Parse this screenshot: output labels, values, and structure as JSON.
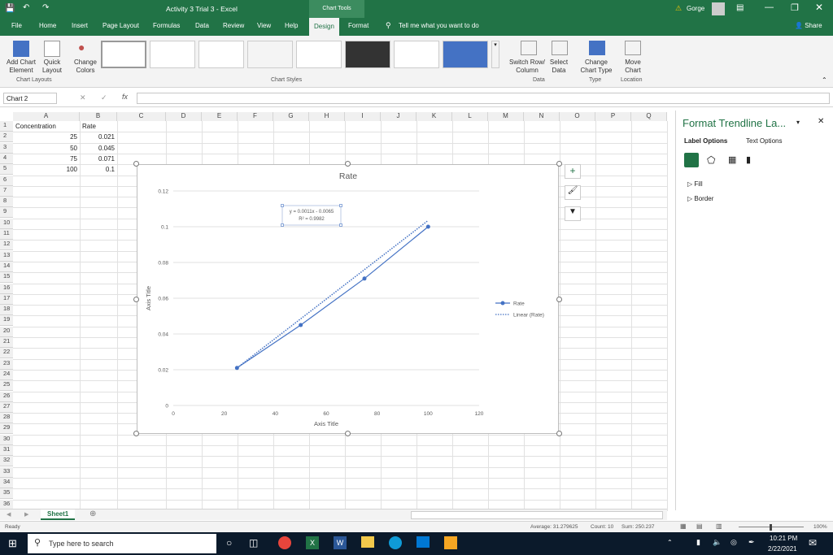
{
  "titlebar": {
    "title": "Activity 3 Trial 3  -  Excel",
    "contextual": "Chart Tools",
    "user": "Gorge"
  },
  "tabs": [
    "File",
    "Home",
    "Insert",
    "Page Layout",
    "Formulas",
    "Data",
    "Review",
    "View",
    "Help",
    "Design",
    "Format"
  ],
  "tell_me": "Tell me what you want to do",
  "share": "Share",
  "ribbon": {
    "add_chart_element": "Add Chart\nElement",
    "quick_layout": "Quick\nLayout",
    "change_colors": "Change\nColors",
    "switch_row_col": "Switch Row/\nColumn",
    "select_data": "Select\nData",
    "change_chart_type": "Change\nChart Type",
    "move_chart": "Move\nChart",
    "groups": {
      "chart_layouts": "Chart Layouts",
      "chart_styles": "Chart Styles",
      "data": "Data",
      "type": "Type",
      "location": "Location"
    }
  },
  "formula": {
    "name_box": "Chart 2",
    "fx": "fx"
  },
  "columns": [
    "A",
    "B",
    "C",
    "D",
    "E",
    "F",
    "G",
    "H",
    "I",
    "J",
    "K",
    "L",
    "M",
    "N",
    "O",
    "P",
    "Q"
  ],
  "rows": [
    "1",
    "2",
    "3",
    "4",
    "5",
    "6",
    "7",
    "8",
    "9",
    "10",
    "11",
    "12",
    "13",
    "14",
    "15",
    "16",
    "17",
    "18",
    "19",
    "20",
    "21",
    "22",
    "23",
    "24",
    "25",
    "26",
    "27",
    "28",
    "29",
    "30",
    "31",
    "32",
    "33",
    "34",
    "35",
    "36"
  ],
  "cells": {
    "A1": "Concentration",
    "B1": "Rate",
    "A2": "25",
    "B2": "0.021",
    "A3": "50",
    "B3": "0.045",
    "A4": "75",
    "B4": "0.071",
    "A5": "100",
    "B5": "0.1"
  },
  "chart_data": {
    "type": "scatter",
    "title": "Rate",
    "xlabel": "Axis Title",
    "ylabel": "Axis Title",
    "xlim": [
      0,
      120
    ],
    "ylim": [
      0,
      0.12
    ],
    "xticks": [
      "0",
      "20",
      "40",
      "60",
      "80",
      "100",
      "120"
    ],
    "yticks": [
      "0",
      "0.02",
      "0.04",
      "0.06",
      "0.08",
      "0.1",
      "0.12"
    ],
    "series": [
      {
        "name": "Rate",
        "x": [
          25,
          50,
          75,
          100
        ],
        "y": [
          0.021,
          0.045,
          0.071,
          0.1
        ],
        "color": "#4472c4"
      }
    ],
    "trendline": {
      "name": "Linear (Rate)",
      "slope": 0.0011,
      "intercept": -0.0065,
      "x": [
        25,
        100
      ]
    },
    "equation": "y = 0.0011x - 0.0065",
    "r2": "R² = 0.9982",
    "legend_position": "right"
  },
  "pane": {
    "title": "Format Trendline La...",
    "tab_label_options": "Label Options",
    "tab_text_options": "Text Options",
    "sections": [
      "Fill",
      "Border"
    ]
  },
  "sheet_tab": "Sheet1",
  "status": {
    "ready": "Ready",
    "average": "Average: 31.279625",
    "count": "Count: 10",
    "sum": "Sum: 250.237",
    "zoom": "100%"
  },
  "taskbar": {
    "search_placeholder": "Type here to search",
    "time": "10:21 PM",
    "date": "2/22/2021"
  },
  "colors": {
    "excel_green": "#217346",
    "series_blue": "#4472c4"
  }
}
